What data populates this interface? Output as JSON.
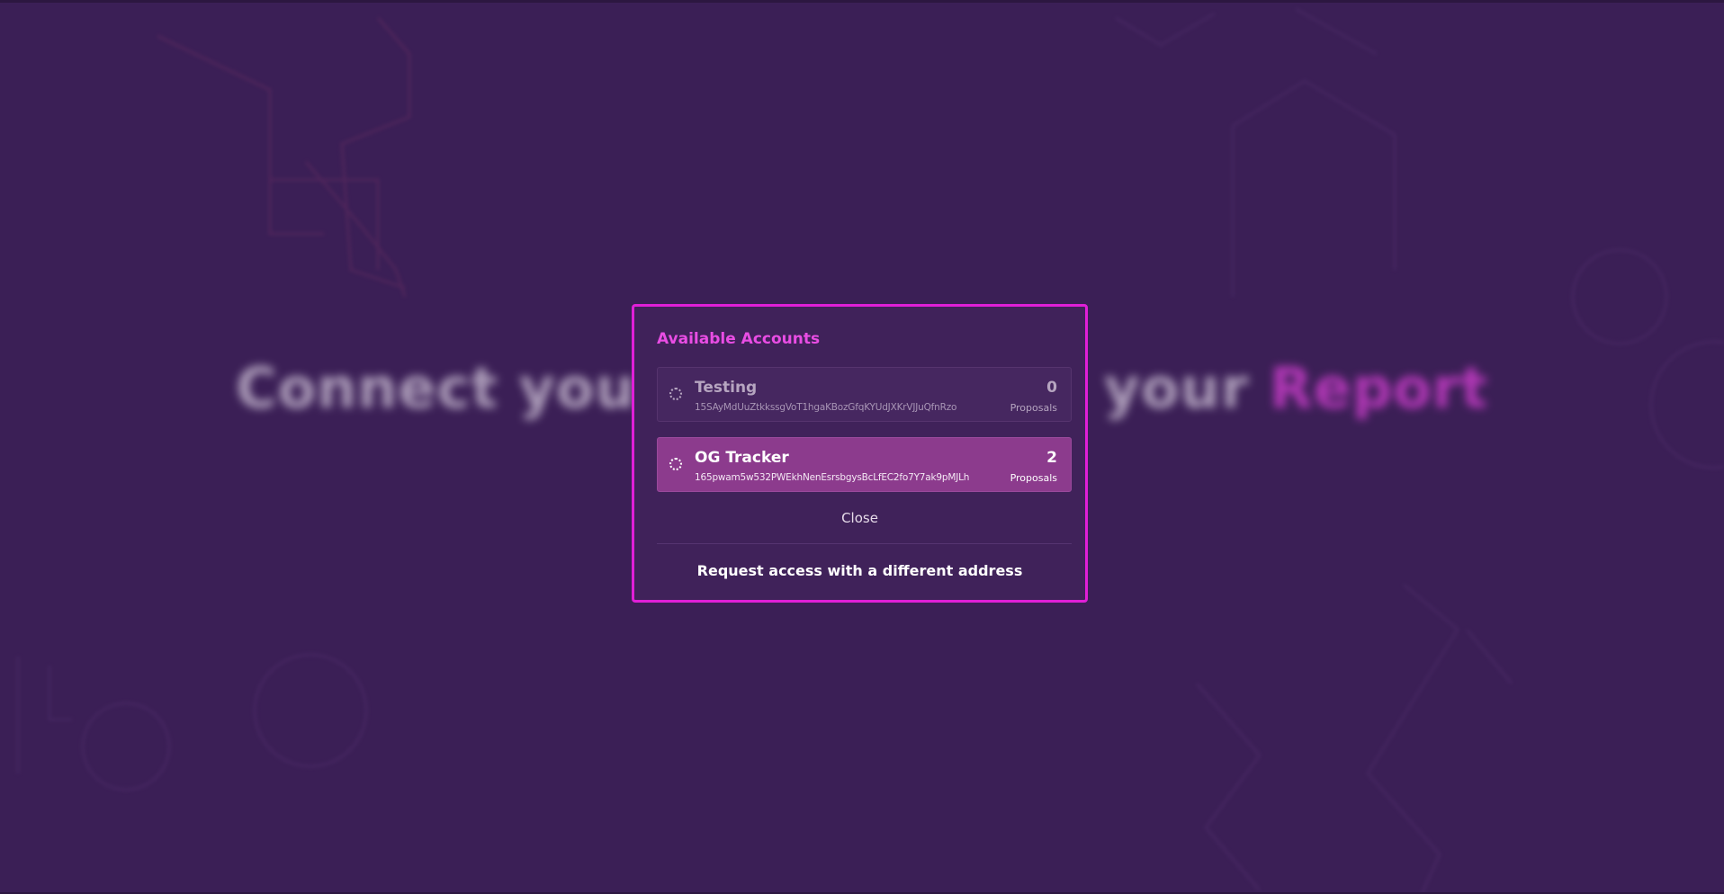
{
  "background": {
    "hero_text_start": "Connect you",
    "hero_text_mid": "your",
    "hero_text_accent": "Report"
  },
  "modal": {
    "title": "Available Accounts",
    "accounts": [
      {
        "name": "Testing",
        "address": "15SAyMdUuZtkkssgVoT1hgaKBozGfqKYUdJXKrVJJuQfnRzo",
        "count": "0",
        "count_label": "Proposals",
        "icon": "loading-dots-icon"
      },
      {
        "name": "OG Tracker",
        "address": "165pwam5w532PWEkhNenEsrsbgysBcLfEC2fo7Y7ak9pMJLh",
        "count": "2",
        "count_label": "Proposals",
        "icon": "loading-dots-icon"
      }
    ],
    "close_label": "Close",
    "request_label": "Request access with a different address"
  },
  "colors": {
    "background": "#3b1f56",
    "modal_border": "#e01fd7",
    "title": "#e94de4",
    "selected_account": "#8c3b8d"
  }
}
